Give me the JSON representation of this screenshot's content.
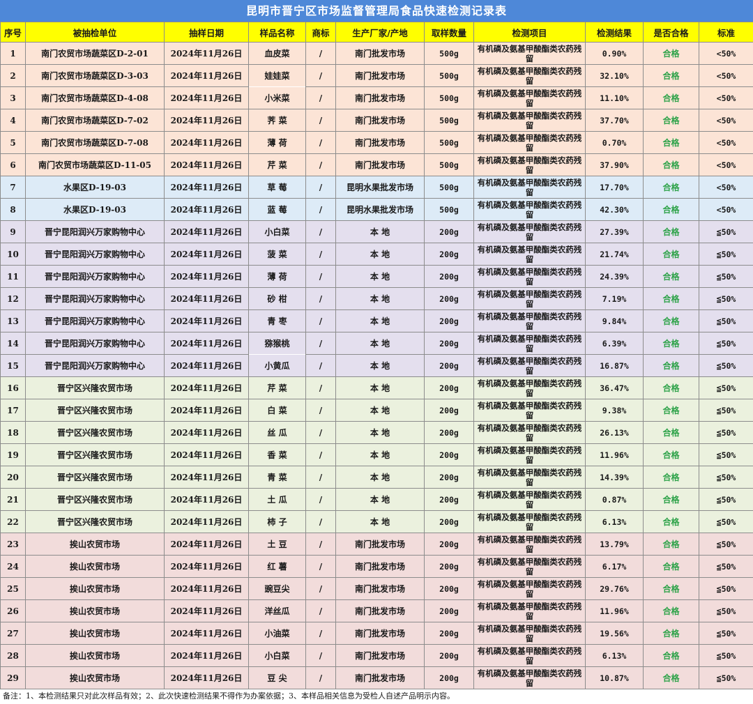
{
  "title": "昆明市晋宁区市场监督管理局食品快速检测记录表",
  "columns": [
    "序号",
    "被抽检单位",
    "抽样日期",
    "样品名称",
    "商标",
    "生产厂家/产地",
    "取样数量",
    "检测项目",
    "检测结果",
    "是否合格",
    "标准"
  ],
  "colors": {
    "header_bg": "#ffff00",
    "title_bg": "#4e88d8",
    "pass_text": "#2fa34a",
    "group_bg": [
      "#fce4d6",
      "#ddebf7",
      "#e4dfee",
      "#ebf1de",
      "#f2dcdb"
    ]
  },
  "rows": [
    {
      "no": "1",
      "unit": "南门农贸市场蔬菜区D-2-01",
      "date": "2024年11月26日",
      "sample": "血皮菜",
      "brand": "/",
      "origin": "南门批发市场",
      "qty": "500g",
      "item": "有机磷及氨基甲酸酯类农药残留",
      "result": "0.90%",
      "pass": "合格",
      "std": "<50%",
      "group": 1
    },
    {
      "no": "2",
      "unit": "南门农贸市场蔬菜区D-3-03",
      "date": "2024年11月26日",
      "sample": "娃娃菜",
      "brand": "/",
      "origin": "南门批发市场",
      "qty": "500g",
      "item": "有机磷及氨基甲酸酯类农药残留",
      "result": "32.10%",
      "pass": "合格",
      "std": "<50%",
      "group": 1
    },
    {
      "no": "3",
      "unit": "南门农贸市场蔬菜区D-4-08",
      "date": "2024年11月26日",
      "sample": "小米菜",
      "brand": "/",
      "origin": "南门批发市场",
      "qty": "500g",
      "item": "有机磷及氨基甲酸酯类农药残留",
      "result": "11.10%",
      "pass": "合格",
      "std": "<50%",
      "group": 1
    },
    {
      "no": "4",
      "unit": "南门农贸市场蔬菜区D-7-02",
      "date": "2024年11月26日",
      "sample": "荠 菜",
      "brand": "/",
      "origin": "南门批发市场",
      "qty": "500g",
      "item": "有机磷及氨基甲酸酯类农药残留",
      "result": "37.70%",
      "pass": "合格",
      "std": "<50%",
      "group": 1
    },
    {
      "no": "5",
      "unit": "南门农贸市场蔬菜区D-7-08",
      "date": "2024年11月26日",
      "sample": "薄 荷",
      "brand": "/",
      "origin": "南门批发市场",
      "qty": "500g",
      "item": "有机磷及氨基甲酸酯类农药残留",
      "result": "0.70%",
      "pass": "合格",
      "std": "<50%",
      "group": 1
    },
    {
      "no": "6",
      "unit": "南门农贸市场蔬菜区D-11-05",
      "date": "2024年11月26日",
      "sample": "芹 菜",
      "brand": "/",
      "origin": "南门批发市场",
      "qty": "500g",
      "item": "有机磷及氨基甲酸酯类农药残留",
      "result": "37.90%",
      "pass": "合格",
      "std": "<50%",
      "group": 1
    },
    {
      "no": "7",
      "unit": "水果区D-19-03",
      "date": "2024年11月26日",
      "sample": "草 莓",
      "brand": "/",
      "origin": "昆明水果批发市场",
      "qty": "500g",
      "item": "有机磷及氨基甲酸酯类农药残留",
      "result": "17.70%",
      "pass": "合格",
      "std": "<50%",
      "group": 2
    },
    {
      "no": "8",
      "unit": "水果区D-19-03",
      "date": "2024年11月26日",
      "sample": "蓝 莓",
      "brand": "/",
      "origin": "昆明水果批发市场",
      "qty": "500g",
      "item": "有机磷及氨基甲酸酯类农药残留",
      "result": "42.30%",
      "pass": "合格",
      "std": "<50%",
      "group": 2
    },
    {
      "no": "9",
      "unit": "晋宁昆阳润兴万家购物中心",
      "date": "2024年11月26日",
      "sample": "小白菜",
      "brand": "/",
      "origin": "本 地",
      "qty": "200g",
      "item": "有机磷及氨基甲酸酯类农药残留",
      "result": "27.39%",
      "pass": "合格",
      "std": "≦50%",
      "group": 3
    },
    {
      "no": "10",
      "unit": "晋宁昆阳润兴万家购物中心",
      "date": "2024年11月26日",
      "sample": "菠 菜",
      "brand": "/",
      "origin": "本 地",
      "qty": "200g",
      "item": "有机磷及氨基甲酸酯类农药残留",
      "result": "21.74%",
      "pass": "合格",
      "std": "≦50%",
      "group": 3
    },
    {
      "no": "11",
      "unit": "晋宁昆阳润兴万家购物中心",
      "date": "2024年11月26日",
      "sample": "薄 荷",
      "brand": "/",
      "origin": "本 地",
      "qty": "200g",
      "item": "有机磷及氨基甲酸酯类农药残留",
      "result": "24.39%",
      "pass": "合格",
      "std": "≦50%",
      "group": 3
    },
    {
      "no": "12",
      "unit": "晋宁昆阳润兴万家购物中心",
      "date": "2024年11月26日",
      "sample": "砂 柑",
      "brand": "/",
      "origin": "本 地",
      "qty": "200g",
      "item": "有机磷及氨基甲酸酯类农药残留",
      "result": "7.19%",
      "pass": "合格",
      "std": "≦50%",
      "group": 3
    },
    {
      "no": "13",
      "unit": "晋宁昆阳润兴万家购物中心",
      "date": "2024年11月26日",
      "sample": "青 枣",
      "brand": "/",
      "origin": "本 地",
      "qty": "200g",
      "item": "有机磷及氨基甲酸酯类农药残留",
      "result": "9.84%",
      "pass": "合格",
      "std": "≦50%",
      "group": 3
    },
    {
      "no": "14",
      "unit": "晋宁昆阳润兴万家购物中心",
      "date": "2024年11月26日",
      "sample": "猕猴桃",
      "brand": "/",
      "origin": "本 地",
      "qty": "200g",
      "item": "有机磷及氨基甲酸酯类农药残留",
      "result": "6.39%",
      "pass": "合格",
      "std": "≦50%",
      "group": 3
    },
    {
      "no": "15",
      "unit": "晋宁昆阳润兴万家购物中心",
      "date": "2024年11月26日",
      "sample": "小黄瓜",
      "brand": "/",
      "origin": "本 地",
      "qty": "200g",
      "item": "有机磷及氨基甲酸酯类农药残留",
      "result": "16.87%",
      "pass": "合格",
      "std": "≦50%",
      "group": 3
    },
    {
      "no": "16",
      "unit": "晋宁区兴隆农贸市场",
      "date": "2024年11月26日",
      "sample": "芹 菜",
      "brand": "/",
      "origin": "本 地",
      "qty": "200g",
      "item": "有机磷及氨基甲酸酯类农药残留",
      "result": "36.47%",
      "pass": "合格",
      "std": "≦50%",
      "group": 4
    },
    {
      "no": "17",
      "unit": "晋宁区兴隆农贸市场",
      "date": "2024年11月26日",
      "sample": "白 菜",
      "brand": "/",
      "origin": "本 地",
      "qty": "200g",
      "item": "有机磷及氨基甲酸酯类农药残留",
      "result": "9.38%",
      "pass": "合格",
      "std": "≦50%",
      "group": 4
    },
    {
      "no": "18",
      "unit": "晋宁区兴隆农贸市场",
      "date": "2024年11月26日",
      "sample": "丝 瓜",
      "brand": "/",
      "origin": "本 地",
      "qty": "200g",
      "item": "有机磷及氨基甲酸酯类农药残留",
      "result": "26.13%",
      "pass": "合格",
      "std": "≦50%",
      "group": 4
    },
    {
      "no": "19",
      "unit": "晋宁区兴隆农贸市场",
      "date": "2024年11月26日",
      "sample": "香 菜",
      "brand": "/",
      "origin": "本 地",
      "qty": "200g",
      "item": "有机磷及氨基甲酸酯类农药残留",
      "result": "11.96%",
      "pass": "合格",
      "std": "≦50%",
      "group": 4
    },
    {
      "no": "20",
      "unit": "晋宁区兴隆农贸市场",
      "date": "2024年11月26日",
      "sample": "青 菜",
      "brand": "/",
      "origin": "本 地",
      "qty": "200g",
      "item": "有机磷及氨基甲酸酯类农药残留",
      "result": "14.39%",
      "pass": "合格",
      "std": "≦50%",
      "group": 4
    },
    {
      "no": "21",
      "unit": "晋宁区兴隆农贸市场",
      "date": "2024年11月26日",
      "sample": "土 瓜",
      "brand": "/",
      "origin": "本 地",
      "qty": "200g",
      "item": "有机磷及氨基甲酸酯类农药残留",
      "result": "0.87%",
      "pass": "合格",
      "std": "≦50%",
      "group": 4
    },
    {
      "no": "22",
      "unit": "晋宁区兴隆农贸市场",
      "date": "2024年11月26日",
      "sample": "柿 子",
      "brand": "/",
      "origin": "本 地",
      "qty": "200g",
      "item": "有机磷及氨基甲酸酯类农药残留",
      "result": "6.13%",
      "pass": "合格",
      "std": "≦50%",
      "group": 4
    },
    {
      "no": "23",
      "unit": "挨山农贸市场",
      "date": "2024年11月26日",
      "sample": "土 豆",
      "brand": "/",
      "origin": "南门批发市场",
      "qty": "200g",
      "item": "有机磷及氨基甲酸酯类农药残留",
      "result": "13.79%",
      "pass": "合格",
      "std": "≦50%",
      "group": 5
    },
    {
      "no": "24",
      "unit": "挨山农贸市场",
      "date": "2024年11月26日",
      "sample": "红 薯",
      "brand": "/",
      "origin": "南门批发市场",
      "qty": "200g",
      "item": "有机磷及氨基甲酸酯类农药残留",
      "result": "6.17%",
      "pass": "合格",
      "std": "≦50%",
      "group": 5
    },
    {
      "no": "25",
      "unit": "挨山农贸市场",
      "date": "2024年11月26日",
      "sample": "豌豆尖",
      "brand": "/",
      "origin": "南门批发市场",
      "qty": "200g",
      "item": "有机磷及氨基甲酸酯类农药残留",
      "result": "29.76%",
      "pass": "合格",
      "std": "≦50%",
      "group": 5
    },
    {
      "no": "26",
      "unit": "挨山农贸市场",
      "date": "2024年11月26日",
      "sample": "洋丝瓜",
      "brand": "/",
      "origin": "南门批发市场",
      "qty": "200g",
      "item": "有机磷及氨基甲酸酯类农药残留",
      "result": "11.96%",
      "pass": "合格",
      "std": "≦50%",
      "group": 5
    },
    {
      "no": "27",
      "unit": "挨山农贸市场",
      "date": "2024年11月26日",
      "sample": "小油菜",
      "brand": "/",
      "origin": "南门批发市场",
      "qty": "200g",
      "item": "有机磷及氨基甲酸酯类农药残留",
      "result": "19.56%",
      "pass": "合格",
      "std": "≦50%",
      "group": 5
    },
    {
      "no": "28",
      "unit": "挨山农贸市场",
      "date": "2024年11月26日",
      "sample": "小白菜",
      "brand": "/",
      "origin": "南门批发市场",
      "qty": "200g",
      "item": "有机磷及氨基甲酸酯类农药残留",
      "result": "6.13%",
      "pass": "合格",
      "std": "≦50%",
      "group": 5
    },
    {
      "no": "29",
      "unit": "挨山农贸市场",
      "date": "2024年11月26日",
      "sample": "豆 尖",
      "brand": "/",
      "origin": "南门批发市场",
      "qty": "200g",
      "item": "有机磷及氨基甲酸酯类农药残留",
      "result": "10.87%",
      "pass": "合格",
      "std": "≦50%",
      "group": 5
    }
  ],
  "footnote": "备注：1、本检测结果只对此次样品有效；2、此次快速检测结果不得作为办案依据；3、本样品相关信息为受检人自述产品明示内容。"
}
